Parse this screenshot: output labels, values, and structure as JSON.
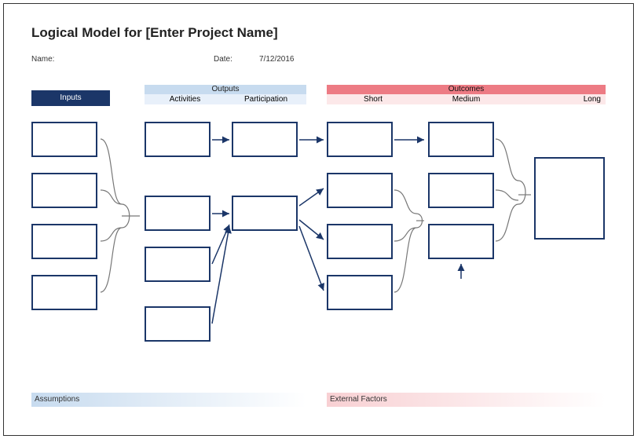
{
  "title_prefix": "Logical Model for ",
  "title_placeholder": "[Enter Project Name]",
  "labels": {
    "name": "Name:",
    "date": "Date:",
    "date_value": "7/12/2016"
  },
  "headers": {
    "inputs": "Inputs",
    "outputs": "Outputs",
    "outputs_sub": {
      "activities": "Activities",
      "participation": "Participation"
    },
    "outcomes": "Outcomes",
    "outcomes_sub": {
      "short": "Short",
      "medium": "Medium",
      "long": "Long"
    }
  },
  "sections": {
    "assumptions": "Assumptions",
    "external": "External Factors"
  }
}
